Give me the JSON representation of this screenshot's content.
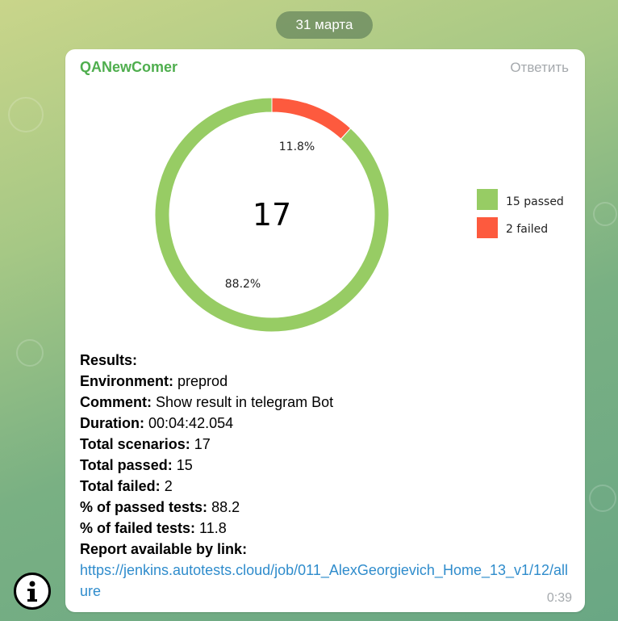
{
  "date_separator": "31 марта",
  "message": {
    "sender": "QANewComer",
    "reply_label": "Ответить",
    "timestamp": "0:39",
    "results_title": "Results:",
    "fields": [
      {
        "label": "Environment:",
        "value": "preprod"
      },
      {
        "label": "Comment:",
        "value": "Show result in telegram Bot"
      },
      {
        "label": "Duration:",
        "value": "00:04:42.054"
      },
      {
        "label": "Total scenarios:",
        "value": "17"
      },
      {
        "label": "Total passed:",
        "value": "15"
      },
      {
        "label": "Total failed:",
        "value": "2"
      },
      {
        "label": "% of passed tests:",
        "value": "88.2"
      },
      {
        "label": "% of failed tests:",
        "value": "11.8"
      }
    ],
    "report_label": "Report available by link:",
    "report_link": "https://jenkins.autotests.cloud/job/011_AlexGeorgievich_Home_13_v1/12/allure"
  },
  "chart_data": {
    "type": "pie",
    "center_label": "17",
    "categories": [
      "15 passed",
      "2 failed"
    ],
    "values": [
      15,
      2
    ],
    "slice_labels": [
      "88.2%",
      "11.8%"
    ],
    "colors": [
      "#97cc64",
      "#fd5a3e"
    ],
    "legend": "right"
  },
  "icons": {
    "info_button": "info-icon"
  }
}
